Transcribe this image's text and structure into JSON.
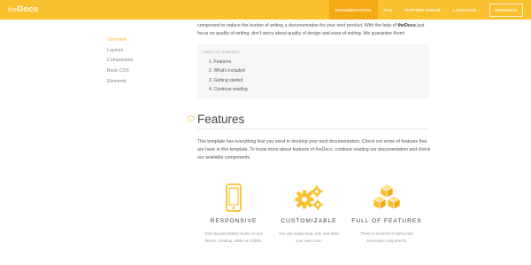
{
  "header": {
    "logo_the": "the",
    "logo_docs": "Docs",
    "nav": [
      {
        "label": "Documentation"
      },
      {
        "label": "FAQ"
      },
      {
        "label": "Support Forum"
      },
      {
        "label": "Language"
      },
      {
        "label": "Purchase"
      }
    ]
  },
  "sidebar": {
    "items": [
      {
        "label": "Overview"
      },
      {
        "label": "Layouts"
      },
      {
        "label": "Components"
      },
      {
        "label": "Basic CSS"
      },
      {
        "label": "Elements"
      }
    ]
  },
  "intro": {
    "line1": "component to reduce the burden of writing a documentation for your next product. With the help of",
    "brand": "theDocs",
    "line1_end": "just",
    "line2": "focus on quality of writing; don't worry about quality of design and ease of writing. We guarantee them!"
  },
  "toc": {
    "title": "Table of content",
    "items": [
      {
        "label": "1.  Features"
      },
      {
        "label": "2.  What's included"
      },
      {
        "label": "3.  Getting started"
      },
      {
        "label": "4.  Continue reading"
      }
    ]
  },
  "features": {
    "hash": "#",
    "title": "Features",
    "description": "This template has everything that you need to develop your next documentation. Check out some of features that are have in this template. To know more about features of theDocs, continue reading our documentation and check our available components.",
    "columns": [
      {
        "icon": "mobile-icon",
        "title": "Responsive",
        "text": "Your documentation works on any device: desktop, tablet or mobile."
      },
      {
        "icon": "gears-icon",
        "title": "Customizable",
        "text": "You can easily read, edit, and write your own code."
      },
      {
        "icon": "cubes-icon",
        "title": "Full of features",
        "text": "There is a bunch of useful and necessary components."
      }
    ]
  },
  "colors": {
    "accent": "#fbc02d",
    "accent_dark": "#f5a912",
    "icon": "#fbc02d"
  }
}
